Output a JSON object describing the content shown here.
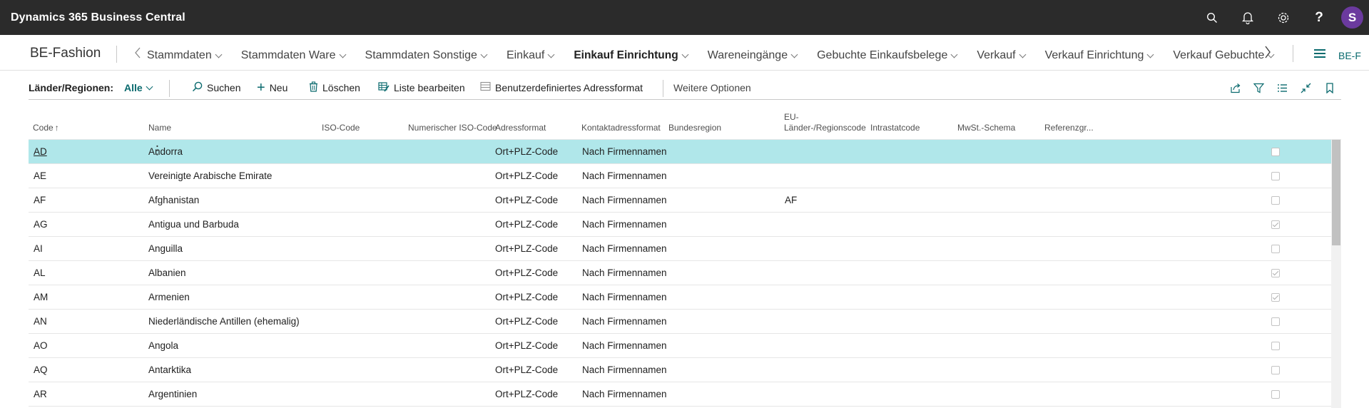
{
  "app": {
    "title": "Dynamics 365 Business Central",
    "avatar_initial": "S",
    "avatar_color": "#6b3a9e",
    "bar_color": "#2b2b2b",
    "accent": "#0a6a6e",
    "icons": [
      "search-icon",
      "bell-icon",
      "gear-icon",
      "help-icon"
    ],
    "help_glyph": "?"
  },
  "nav": {
    "company": "BE-Fashion",
    "items": [
      {
        "label": "Stammdaten",
        "active": false
      },
      {
        "label": "Stammdaten Ware",
        "active": false
      },
      {
        "label": "Stammdaten Sonstige",
        "active": false
      },
      {
        "label": "Einkauf",
        "active": false
      },
      {
        "label": "Einkauf Einrichtung",
        "active": true
      },
      {
        "label": "Wareneingänge",
        "active": false
      },
      {
        "label": "Gebuchte Einkaufsbelege",
        "active": false
      },
      {
        "label": "Verkauf",
        "active": false
      },
      {
        "label": "Verkauf Einrichtung",
        "active": false
      },
      {
        "label": "Verkauf Gebuchte",
        "active": false
      }
    ],
    "company_code": "BE-F"
  },
  "actions": {
    "page_label": "Länder/Regionen:",
    "filter_value": "Alle",
    "search": "Suchen",
    "new": "Neu",
    "delete": "Löschen",
    "edit_list": "Liste bearbeiten",
    "custom_format": "Benutzerdefiniertes Adressformat",
    "more": "Weitere Optionen",
    "right_icons": [
      "share-icon",
      "filter-icon",
      "list-view-icon",
      "collapse-icon",
      "bookmark-icon"
    ]
  },
  "table": {
    "columns": [
      "Code",
      "Name",
      "ISO-Code",
      "Numerischer ISO-Code",
      "Adressformat",
      "Kontaktadressformat",
      "Bundesregion",
      "EU-Länder-/Regionscode",
      "Intrastatcode",
      "MwSt.-Schema",
      "Referenzgr..."
    ],
    "sort_indicator": "↑",
    "selected_color": "#b0e7ea",
    "rows": [
      {
        "code": "AD",
        "name": "Andorra",
        "iso": "",
        "num_iso": "",
        "addr": "Ort+PLZ-Code",
        "contact": "Nach Firmennamen",
        "region": "",
        "eu": "",
        "intrastat": "",
        "vat": "",
        "ref": false,
        "selected": true
      },
      {
        "code": "AE",
        "name": "Vereinigte Arabische Emirate",
        "iso": "",
        "num_iso": "",
        "addr": "Ort+PLZ-Code",
        "contact": "Nach Firmennamen",
        "region": "",
        "eu": "",
        "intrastat": "",
        "vat": "",
        "ref": false,
        "selected": false
      },
      {
        "code": "AF",
        "name": "Afghanistan",
        "iso": "",
        "num_iso": "",
        "addr": "Ort+PLZ-Code",
        "contact": "Nach Firmennamen",
        "region": "",
        "eu": "AF",
        "intrastat": "",
        "vat": "",
        "ref": false,
        "selected": false
      },
      {
        "code": "AG",
        "name": "Antigua und Barbuda",
        "iso": "",
        "num_iso": "",
        "addr": "Ort+PLZ-Code",
        "contact": "Nach Firmennamen",
        "region": "",
        "eu": "",
        "intrastat": "",
        "vat": "",
        "ref": true,
        "selected": false
      },
      {
        "code": "AI",
        "name": "Anguilla",
        "iso": "",
        "num_iso": "",
        "addr": "Ort+PLZ-Code",
        "contact": "Nach Firmennamen",
        "region": "",
        "eu": "",
        "intrastat": "",
        "vat": "",
        "ref": false,
        "selected": false
      },
      {
        "code": "AL",
        "name": "Albanien",
        "iso": "",
        "num_iso": "",
        "addr": "Ort+PLZ-Code",
        "contact": "Nach Firmennamen",
        "region": "",
        "eu": "",
        "intrastat": "",
        "vat": "",
        "ref": true,
        "selected": false
      },
      {
        "code": "AM",
        "name": "Armenien",
        "iso": "",
        "num_iso": "",
        "addr": "Ort+PLZ-Code",
        "contact": "Nach Firmennamen",
        "region": "",
        "eu": "",
        "intrastat": "",
        "vat": "",
        "ref": true,
        "selected": false
      },
      {
        "code": "AN",
        "name": "Niederländische Antillen (ehemalig)",
        "iso": "",
        "num_iso": "",
        "addr": "Ort+PLZ-Code",
        "contact": "Nach Firmennamen",
        "region": "",
        "eu": "",
        "intrastat": "",
        "vat": "",
        "ref": false,
        "selected": false
      },
      {
        "code": "AO",
        "name": "Angola",
        "iso": "",
        "num_iso": "",
        "addr": "Ort+PLZ-Code",
        "contact": "Nach Firmennamen",
        "region": "",
        "eu": "",
        "intrastat": "",
        "vat": "",
        "ref": false,
        "selected": false
      },
      {
        "code": "AQ",
        "name": "Antarktika",
        "iso": "",
        "num_iso": "",
        "addr": "Ort+PLZ-Code",
        "contact": "Nach Firmennamen",
        "region": "",
        "eu": "",
        "intrastat": "",
        "vat": "",
        "ref": false,
        "selected": false
      },
      {
        "code": "AR",
        "name": "Argentinien",
        "iso": "",
        "num_iso": "",
        "addr": "Ort+PLZ-Code",
        "contact": "Nach Firmennamen",
        "region": "",
        "eu": "",
        "intrastat": "",
        "vat": "",
        "ref": false,
        "selected": false
      }
    ]
  }
}
